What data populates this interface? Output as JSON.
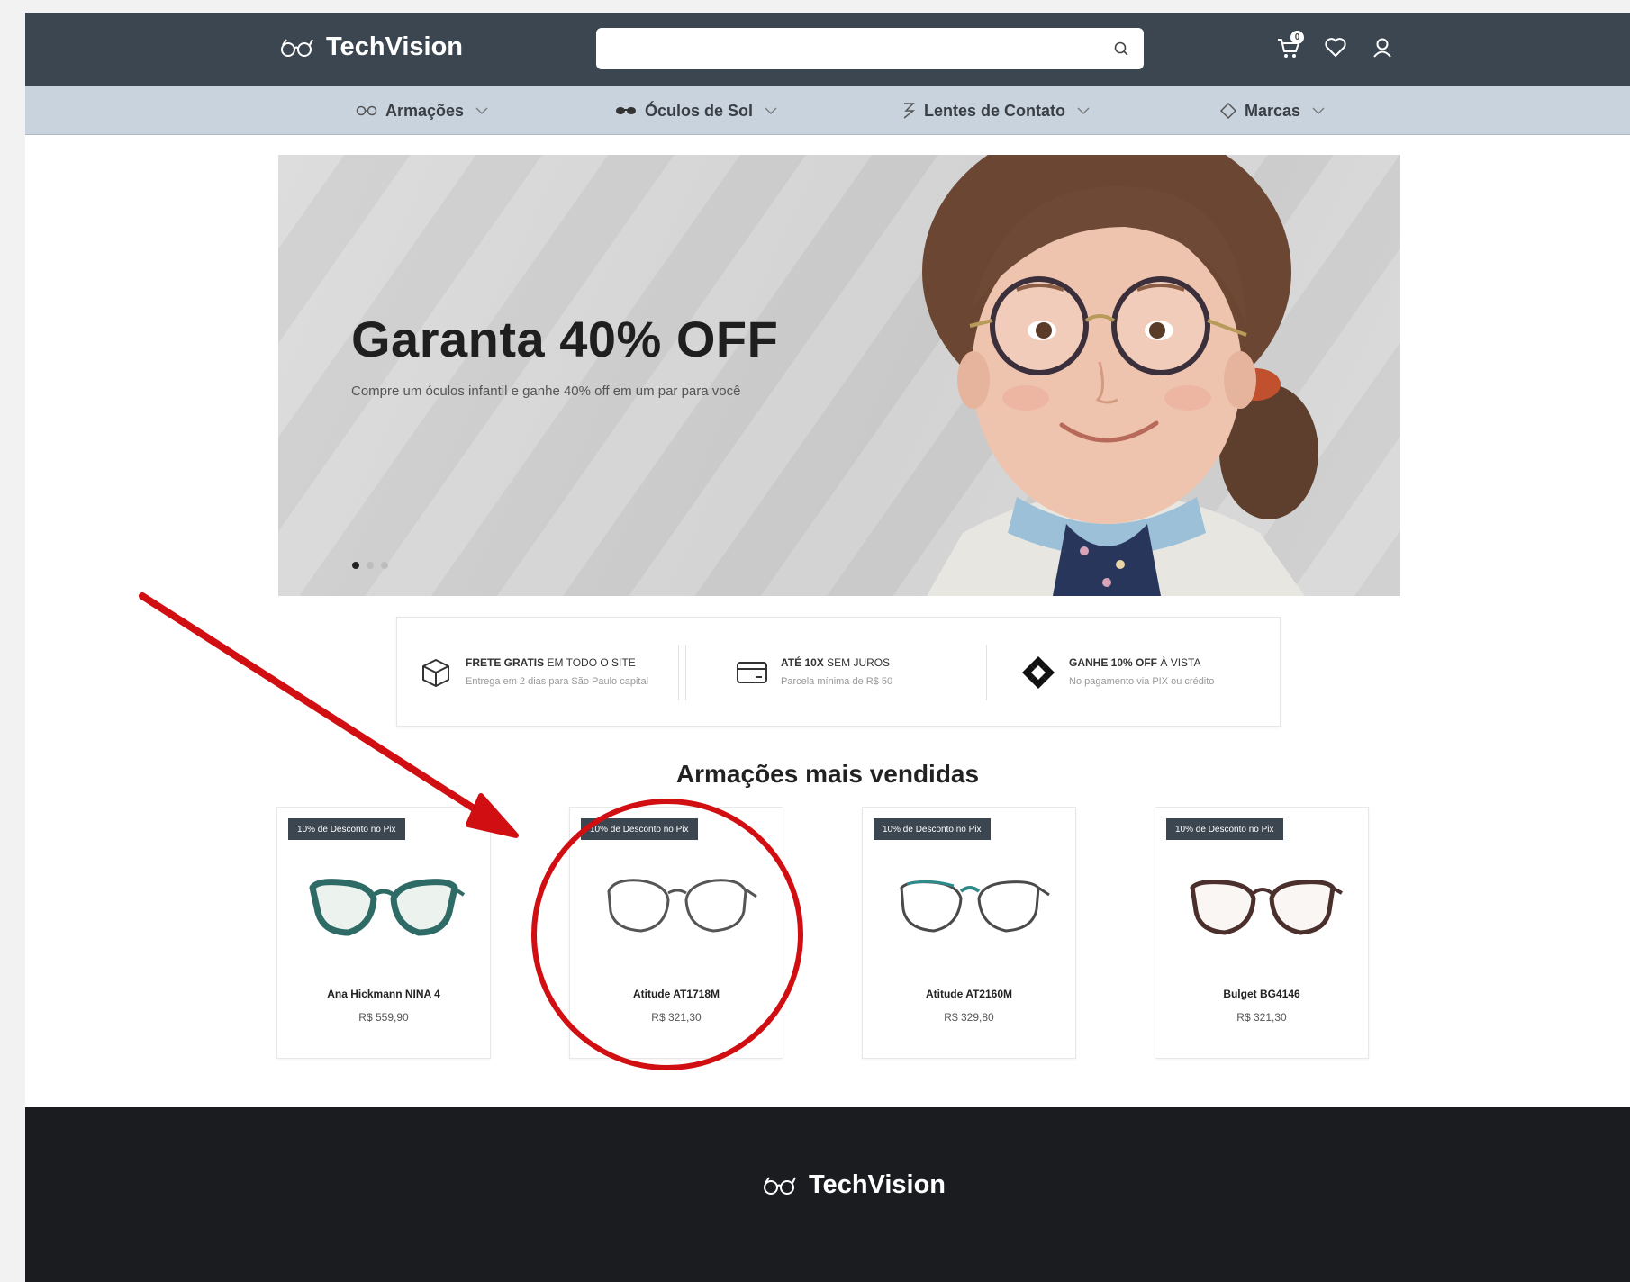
{
  "header": {
    "brand": "TechVision",
    "search": {
      "placeholder": "",
      "value": ""
    },
    "cart_count": "0"
  },
  "nav": {
    "items": [
      {
        "label": "Armações",
        "icon": "glasses-outline-icon"
      },
      {
        "label": "Óculos de Sol",
        "icon": "sunglasses-icon"
      },
      {
        "label": "Lentes de Contato",
        "icon": "contact-lens-icon"
      },
      {
        "label": "Marcas",
        "icon": "tag-icon"
      }
    ]
  },
  "hero": {
    "title": "Garanta 40% OFF",
    "subtitle": "Compre um óculos infantil e ganhe 40% off em um par para você",
    "slide_count": 3,
    "active_slide": 0
  },
  "benefits": [
    {
      "title_bold": "FRETE GRATIS",
      "title_rest": " EM TODO O SITE",
      "desc": "Entrega em 2 dias para São Paulo capital",
      "icon": "box-icon"
    },
    {
      "title_bold": "ATÉ 10X",
      "title_rest": " SEM JUROS",
      "desc": "Parcela mínima de R$ 50",
      "icon": "credit-card-icon"
    },
    {
      "title_bold": "GANHE 10% OFF",
      "title_rest": " À VISTA",
      "desc": "No pagamento via PIX ou crédito",
      "icon": "pix-icon"
    }
  ],
  "section": {
    "title": "Armações mais vendidas"
  },
  "products": [
    {
      "badge": "10% de Desconto no Pix",
      "name": "Ana Hickmann NINA 4",
      "price": "R$ 559,90",
      "frame_color": "#2f6b66"
    },
    {
      "badge": "10% de Desconto no Pix",
      "name": "Atitude AT1718M",
      "price": "R$ 321,30",
      "frame_color": "#555555"
    },
    {
      "badge": "10% de Desconto no Pix",
      "name": "Atitude AT2160M",
      "price": "R$ 329,80",
      "frame_color": "#4a4a4a"
    },
    {
      "badge": "10% de Desconto no Pix",
      "name": "Bulget BG4146",
      "price": "R$ 321,30",
      "frame_color": "#4a2f2c"
    }
  ],
  "footer": {
    "brand": "TechVision"
  },
  "colors": {
    "header_bg": "#3c4650",
    "nav_bg": "#c9d3dd",
    "footer_bg": "#1b1c1f",
    "annotation_red": "#d10f12"
  }
}
